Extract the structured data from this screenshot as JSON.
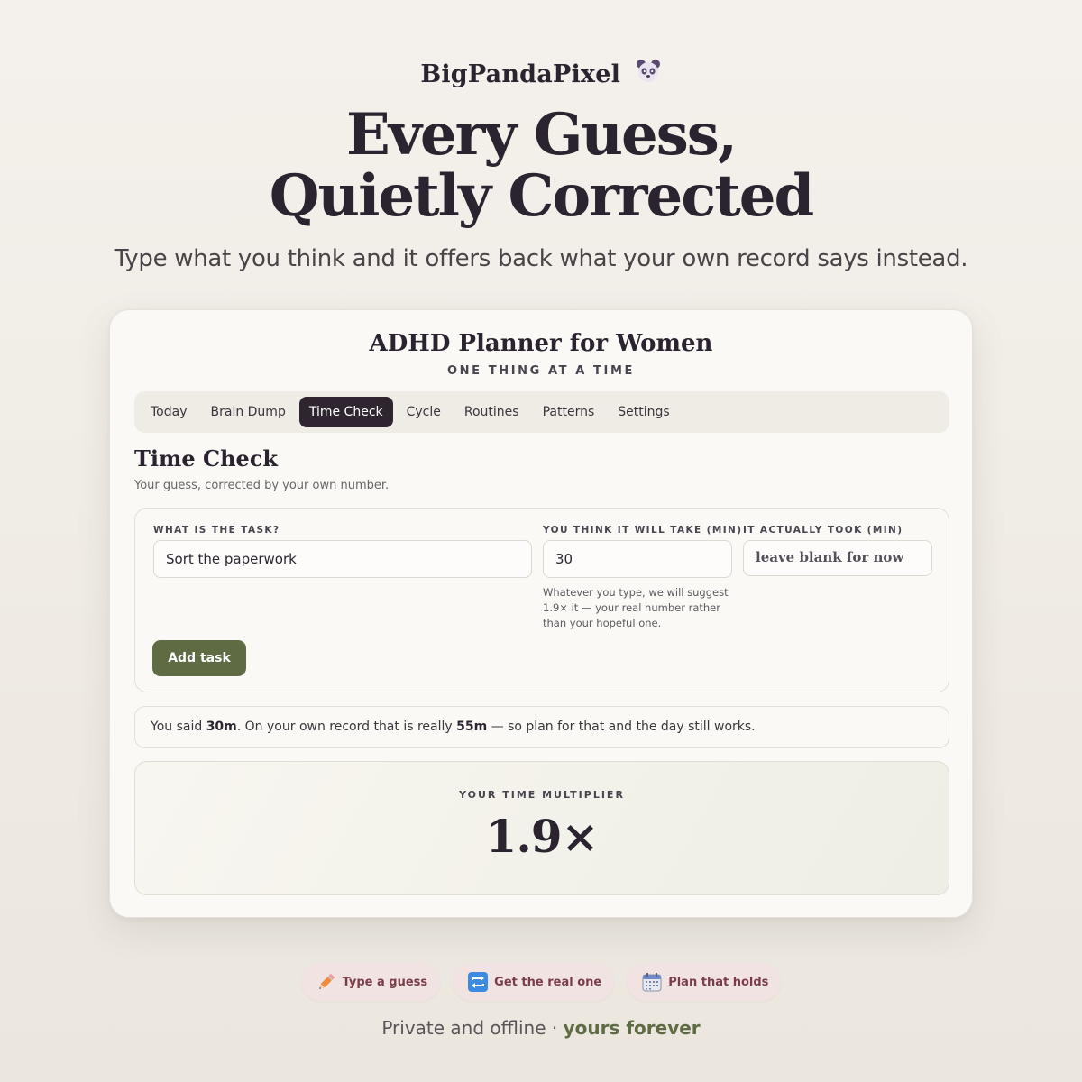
{
  "brand": {
    "name": "BigPandaPixel",
    "emoji_icon": "panda-icon"
  },
  "hero": {
    "headline_line1": "Every Guess,",
    "headline_line2": "Quietly Corrected",
    "subhead": "Type what you think and it offers back what your own record says instead."
  },
  "app": {
    "title": "ADHD Planner for Women",
    "subtitle": "ONE THING AT A TIME",
    "tabs": [
      {
        "label": "Today"
      },
      {
        "label": "Brain Dump"
      },
      {
        "label": "Time Check",
        "active": true
      },
      {
        "label": "Cycle"
      },
      {
        "label": "Routines"
      },
      {
        "label": "Patterns"
      },
      {
        "label": "Settings"
      }
    ]
  },
  "time_check": {
    "title": "Time Check",
    "subtitle": "Your guess, corrected by your own number.",
    "task_label": "WHAT IS THE TASK?",
    "task_value": "Sort the paperwork",
    "guess_label": "YOU THINK IT WILL TAKE (MIN)",
    "guess_value": "30",
    "guess_hint": "Whatever you type, we will suggest 1.9× it — your real number rather than your hopeful one.",
    "actual_label": "IT ACTUALLY TOOK (MIN)",
    "actual_placeholder": "leave blank for now",
    "add_button": "Add task",
    "result": {
      "prefix": "You said ",
      "said": "30m",
      "middle": ". On your own record that is really ",
      "really": "55m",
      "suffix": " — so plan for that and the day still works."
    },
    "multiplier_label": "YOUR TIME MULTIPLIER",
    "multiplier_value": "1.9×"
  },
  "pills": [
    {
      "icon": "pencil-icon",
      "label": "Type a guess"
    },
    {
      "icon": "repeat-arrows-icon",
      "label": "Get the real one"
    },
    {
      "icon": "calendar-icon",
      "label": "Plan that holds"
    }
  ],
  "footer": {
    "text": "Private and offline · ",
    "accent": "yours forever"
  },
  "colors": {
    "background": "#f2eee8",
    "ink": "#2b2430",
    "active_tab": "#2e2530",
    "button_green": "#5e6b43",
    "pill_bg": "#f1e3e1",
    "pill_text": "#7a3d48"
  }
}
